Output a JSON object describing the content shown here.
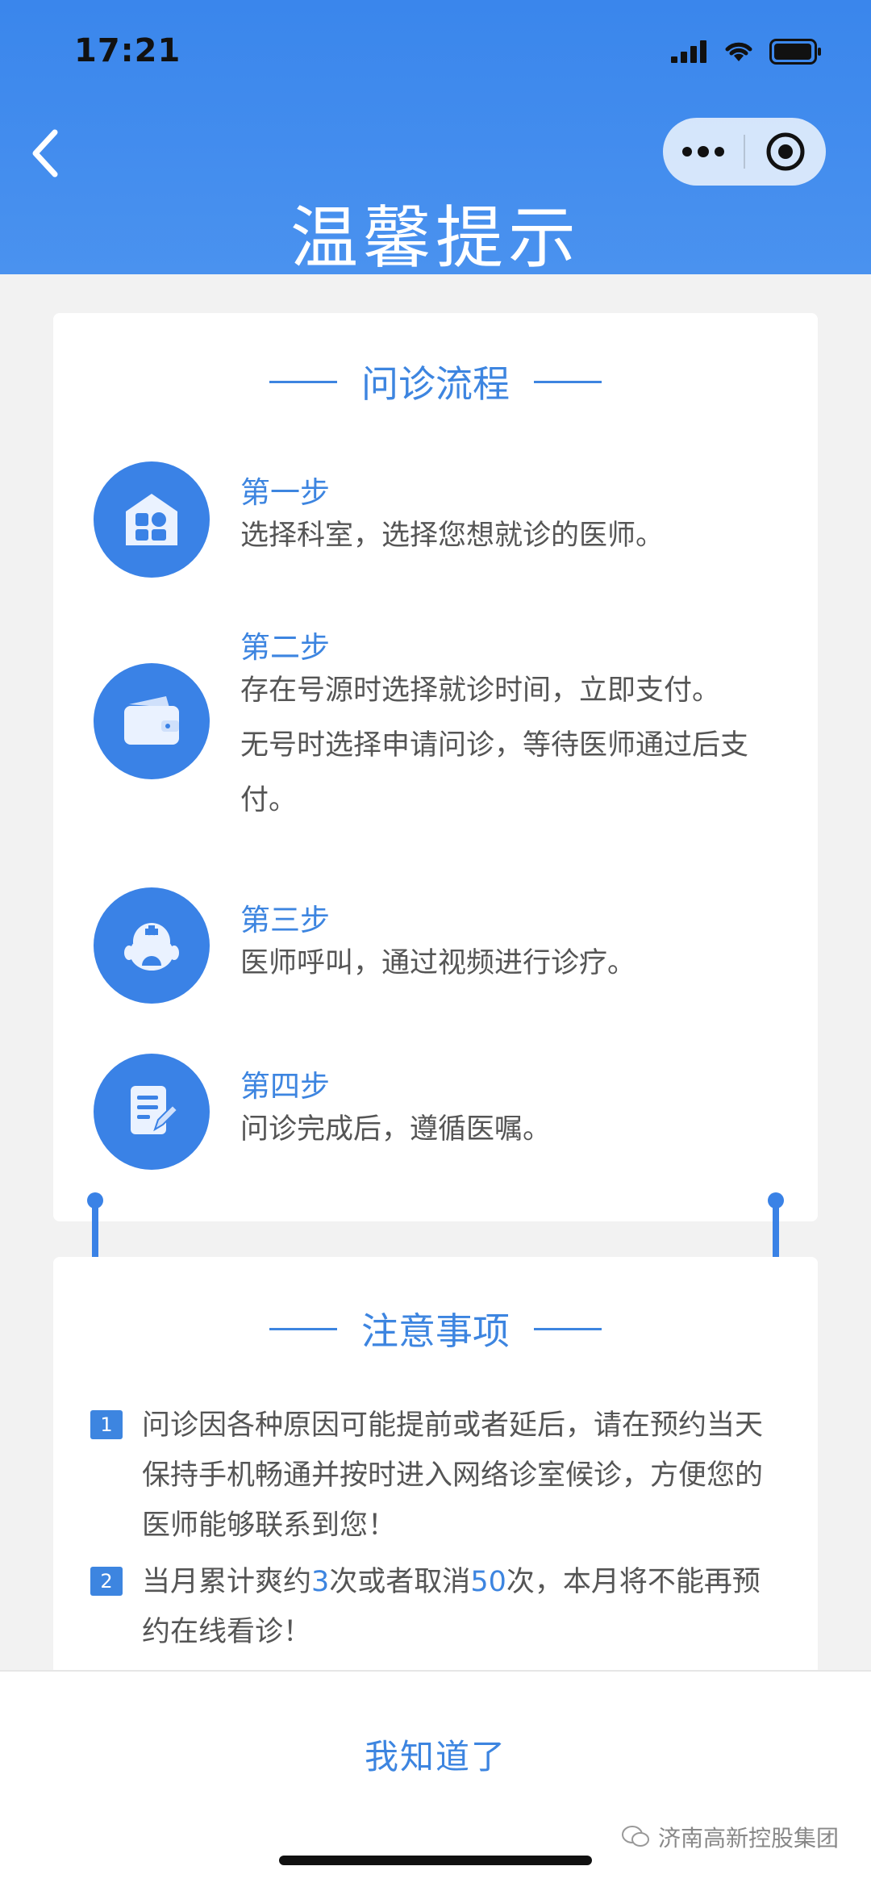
{
  "status_bar": {
    "time": "17:21"
  },
  "header": {
    "title": "温馨提示"
  },
  "process": {
    "heading": "问诊流程",
    "steps": [
      {
        "label": "第一步",
        "lines": [
          "选择科室，选择您想就诊的医师。"
        ]
      },
      {
        "label": "第二步",
        "lines": [
          "存在号源时选择就诊时间，立即支付。",
          "无号时选择申请问诊，等待医师通过后支",
          "付。"
        ]
      },
      {
        "label": "第三步",
        "lines": [
          "医师呼叫，通过视频进行诊疗。"
        ]
      },
      {
        "label": "第四步",
        "lines": [
          "问诊完成后，遵循医嘱。"
        ]
      }
    ]
  },
  "notices": {
    "heading": "注意事项",
    "items": [
      {
        "num": "1",
        "lines": [
          "问诊因各种原因可能提前或者延后，请在预约当天",
          "保持手机畅通并按时进入网络诊室候诊，方便您的",
          "医师能够联系到您！"
        ]
      },
      {
        "num": "2",
        "line1_a": "当月累计爽约",
        "line1_n1": "3",
        "line1_b": "次或者取消",
        "line1_n2": "50",
        "line1_c": "次，本月将不能再预",
        "line2": "约在线看诊！"
      }
    ]
  },
  "bottom": {
    "ok_label": "我知道了"
  },
  "watermark": {
    "text": "济南高新控股集团"
  },
  "icons": {
    "back": "chevron-left-icon",
    "more": "more-dots-icon",
    "close": "target-circle-icon",
    "step1": "department-building-icon",
    "step2": "wallet-icon",
    "step3": "doctor-icon",
    "step4": "document-edit-icon"
  },
  "colors": {
    "primary": "#3a82e6",
    "header": "#3a86ec",
    "text": "#555555"
  }
}
